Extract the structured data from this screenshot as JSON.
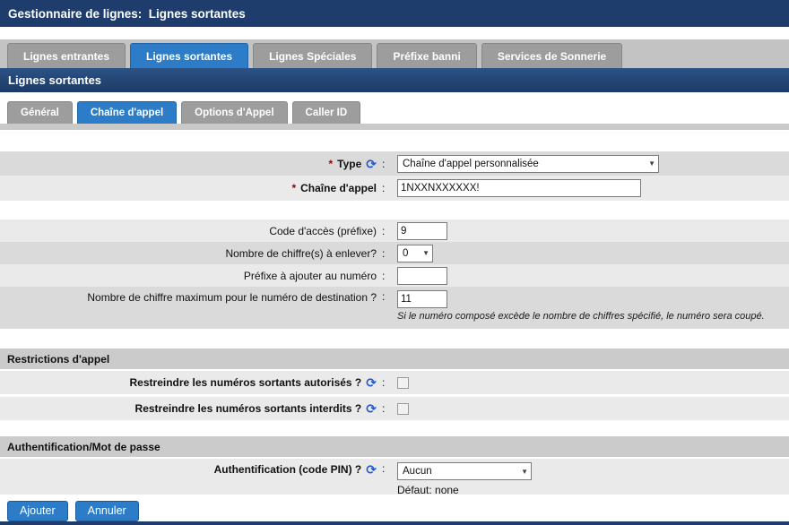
{
  "header": {
    "title": "Gestionnaire de lignes:  Lignes sortantes"
  },
  "main_tabs": [
    {
      "label": "Lignes entrantes"
    },
    {
      "label": "Lignes sortantes"
    },
    {
      "label": "Lignes Spéciales"
    },
    {
      "label": "Préfixe banni"
    },
    {
      "label": "Services de Sonnerie"
    }
  ],
  "section_title": "Lignes sortantes",
  "sub_tabs": [
    {
      "label": "Général"
    },
    {
      "label": "Chaîne d'appel"
    },
    {
      "label": "Options d'Appel"
    },
    {
      "label": "Caller ID"
    }
  ],
  "ui": {
    "colon": ":",
    "required_mark": "*"
  },
  "icons": {
    "refresh": "⟳",
    "dropdown_arrow": "▼"
  },
  "form": {
    "type": {
      "label": "Type",
      "value": "Chaîne d'appel personnalisée"
    },
    "dial_string": {
      "label": "Chaîne d'appel",
      "value": "1NXXNXXXXXX!"
    },
    "access_code": {
      "label": "Code d'accès (préfixe)",
      "value": "9"
    },
    "digits_to_strip": {
      "label": "Nombre de chiffre(s) à enlever?",
      "value": "0"
    },
    "prefix_to_add": {
      "label": "Préfixe à ajouter au numéro",
      "value": ""
    },
    "max_digits": {
      "label": "Nombre de chiffre maximum pour le numéro de destination ?",
      "value": "11",
      "note": "Si le numéro composé excède le nombre de chiffres spécifié, le numéro sera coupé."
    },
    "restrictions_header": "Restrictions d'appel",
    "restrict_allowed": {
      "label": "Restreindre les numéros sortants autorisés ?"
    },
    "restrict_forbidden": {
      "label": "Restreindre les numéros sortants interdits ?"
    },
    "auth_header": "Authentification/Mot de passe",
    "auth_pin": {
      "label": "Authentification (code PIN) ?",
      "value": "Aucun",
      "default_note": "Défaut: none"
    }
  },
  "buttons": {
    "add": "Ajouter",
    "cancel": "Annuler"
  },
  "colors": {
    "navy": "#1e3c6c",
    "active_blue": "#2c7cc8",
    "tab_gray": "#9d9d9d",
    "required_red": "#990000",
    "refresh_blue": "#2057c9"
  }
}
